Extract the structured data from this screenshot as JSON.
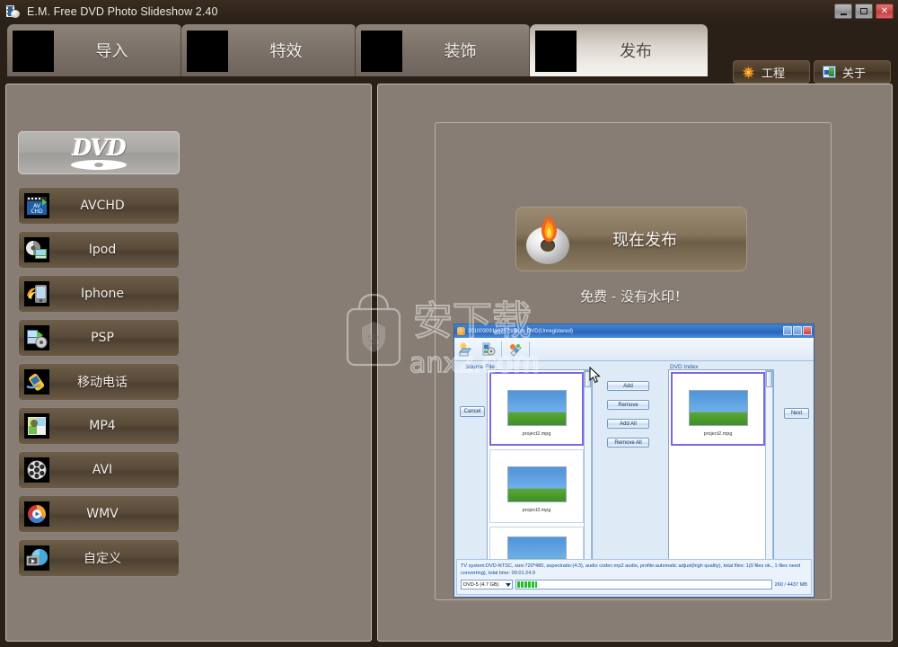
{
  "window": {
    "title": "E.M. Free DVD Photo Slideshow 2.40",
    "icon": "film-disc-icon",
    "minimize_label": "–",
    "maximize_label": "□",
    "close_label": "✕"
  },
  "tabs": [
    {
      "label": "导入",
      "name": "tab-import",
      "active": false
    },
    {
      "label": "特效",
      "name": "tab-effects",
      "active": false
    },
    {
      "label": "装饰",
      "name": "tab-decorate",
      "active": false
    },
    {
      "label": "发布",
      "name": "tab-publish",
      "active": true
    }
  ],
  "toolbar": {
    "project_label": "工程",
    "project_icon": "gear-icon",
    "about_label": "关于",
    "about_icon": "about-icon"
  },
  "formats": [
    {
      "label": "DVD",
      "name": "format-dvd",
      "icon": "dvd-logo-icon",
      "selected": true
    },
    {
      "label": "AVCHD",
      "name": "format-avchd",
      "icon": "avchd-icon",
      "selected": false
    },
    {
      "label": "Ipod",
      "name": "format-ipod",
      "icon": "ipod-icon",
      "selected": false
    },
    {
      "label": "Iphone",
      "name": "format-iphone",
      "icon": "iphone-icon",
      "selected": false
    },
    {
      "label": "PSP",
      "name": "format-psp",
      "icon": "psp-icon",
      "selected": false
    },
    {
      "label": "移动电话",
      "name": "format-mobile",
      "icon": "mobile-phone-icon",
      "selected": false
    },
    {
      "label": "MP4",
      "name": "format-mp4",
      "icon": "mp4-icon",
      "selected": false
    },
    {
      "label": "AVI",
      "name": "format-avi",
      "icon": "avi-film-icon",
      "selected": false
    },
    {
      "label": "WMV",
      "name": "format-wmv",
      "icon": "wmv-icon",
      "selected": false
    },
    {
      "label": "自定义",
      "name": "format-custom",
      "icon": "custom-icon",
      "selected": false
    }
  ],
  "publish": {
    "burn_label": "现在发布",
    "burn_icon": "burning-disc-icon",
    "free_note": "免费 - 没有水印！"
  },
  "screenshot": {
    "title": "20100309110757 - Burn DVD(Unregistered)",
    "source_label": "Source File",
    "index_label": "DVD Index",
    "buttons": {
      "cancel": "Cancel",
      "add": "Add",
      "remove": "Remove",
      "add_all": "Add All",
      "remove_all": "Remove All",
      "next": "Next"
    },
    "source_items": [
      {
        "caption": "project2.mpg",
        "selected": true
      },
      {
        "caption": "project3.mpg",
        "selected": false
      },
      {
        "caption": "",
        "selected": false
      }
    ],
    "index_items": [
      {
        "caption": "project2.mpg",
        "selected": true
      }
    ],
    "status_text": "TV system:DVD-NTSC, size:720*480, aspectratio:(4:3), audio codec:mp2 audio, profile:automatic adjust(high quality), total files: 1(0 files ok., 1 files need converting), total time: 00:01:24.9",
    "disc_type": "DVD-5 (4.7 GB)",
    "size_text": "260 / 4437 MB"
  },
  "watermark": {
    "text_cn": "安下载",
    "text_en": "anxz.com",
    "badge": "安"
  },
  "colors": {
    "app_background": "#2a2017",
    "panel": "#877d74",
    "tab_active": "#eeebe6",
    "button_brown": "#5b4c3a",
    "accent_blue": "#2f6fc4"
  }
}
